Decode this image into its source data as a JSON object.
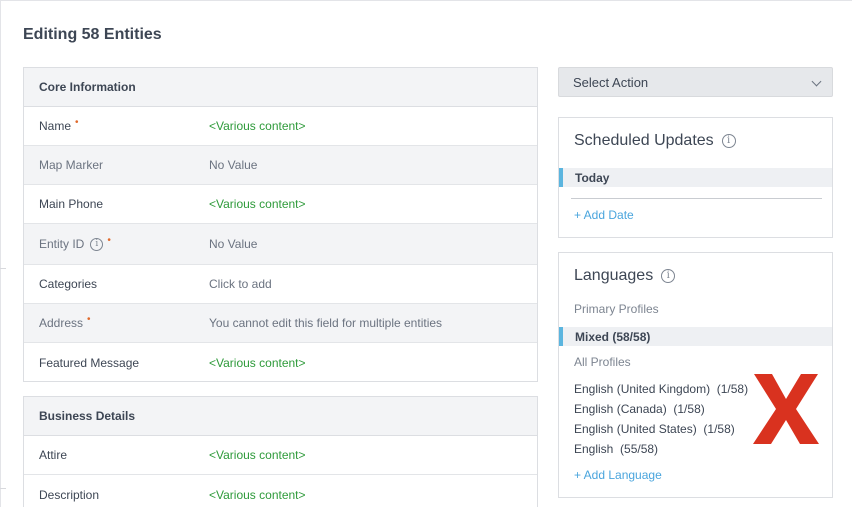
{
  "page": {
    "title": "Editing 58 Entities"
  },
  "core": {
    "header": "Core Information",
    "rows": [
      {
        "label": "Name",
        "value": "<Various content>"
      },
      {
        "label": "Map Marker",
        "value": "No Value"
      },
      {
        "label": "Main Phone",
        "value": "<Various content>"
      },
      {
        "label": "Entity ID",
        "value": "No Value"
      },
      {
        "label": "Categories",
        "value": "Click to add"
      },
      {
        "label": "Address",
        "value": "You cannot edit this field for multiple entities"
      },
      {
        "label": "Featured Message",
        "value": "<Various content>"
      }
    ],
    "required_mark": "•",
    "info_glyph": "i"
  },
  "business": {
    "header": "Business Details",
    "rows": [
      {
        "label": "Attire",
        "value": "<Various content>"
      },
      {
        "label": "Description",
        "value": "<Various content>"
      }
    ]
  },
  "action": {
    "label": "Select Action"
  },
  "scheduled": {
    "title": "Scheduled Updates",
    "today": "Today",
    "add_date": "+ Add Date"
  },
  "languages": {
    "title": "Languages",
    "primary_label": "Primary Profiles",
    "primary_value": "Mixed (58/58)",
    "all_label": "All Profiles",
    "items": [
      "English (United Kingdom)  (1/58)",
      "English (Canada)  (1/58)",
      "English (United States)  (1/58)",
      "English  (55/58)"
    ],
    "add_language": "+ Add Language"
  },
  "colors": {
    "various_content": "#2e9a3a",
    "required": "#e06a2c",
    "link": "#4aa5dd",
    "accent": "#5bb5df",
    "red_x": "#d9321f"
  },
  "icons": {
    "info": "info-icon",
    "chevron": "chevron-down-icon",
    "overlay": "red-x-icon"
  }
}
